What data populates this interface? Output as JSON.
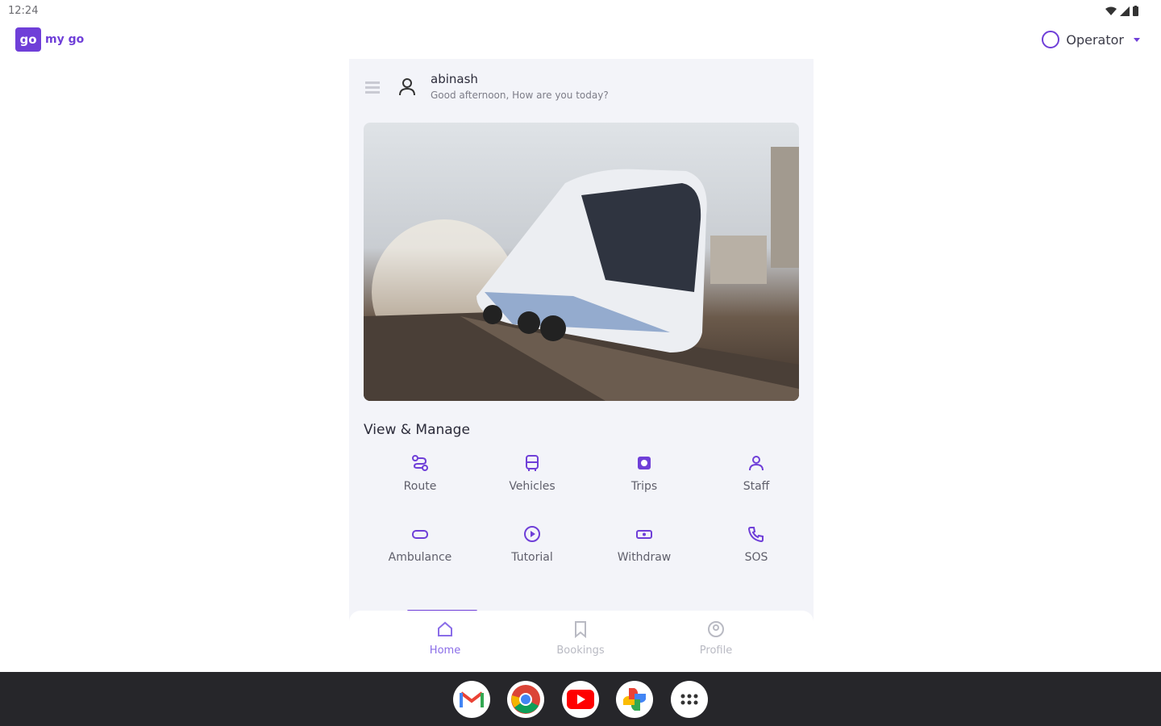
{
  "status_bar": {
    "time": "12:24"
  },
  "app": {
    "logo_text": "my go",
    "logo_mark": "go"
  },
  "account": {
    "role": "Operator"
  },
  "greeting": {
    "name": "abinash",
    "message": "Good afternoon, How are you today?"
  },
  "section": {
    "title": "View & Manage"
  },
  "tiles": [
    {
      "label": "Route",
      "icon": "route-icon"
    },
    {
      "label": "Vehicles",
      "icon": "bus-icon"
    },
    {
      "label": "Trips",
      "icon": "trips-icon"
    },
    {
      "label": "Staff",
      "icon": "staff-icon"
    },
    {
      "label": "Ambulance",
      "icon": "ambulance-icon"
    },
    {
      "label": "Tutorial",
      "icon": "play-icon"
    },
    {
      "label": "Withdraw",
      "icon": "withdraw-icon"
    },
    {
      "label": "SOS",
      "icon": "phone-icon"
    }
  ],
  "bottom_nav": {
    "home": "Home",
    "bookings": "Bookings",
    "profile": "Profile"
  },
  "dock": [
    "Gmail",
    "Chrome",
    "YouTube",
    "Photos",
    "App drawer"
  ],
  "colors": {
    "accent": "#6f3fd8",
    "panel": "#f3f4f9",
    "taskbar": "#26262a"
  }
}
